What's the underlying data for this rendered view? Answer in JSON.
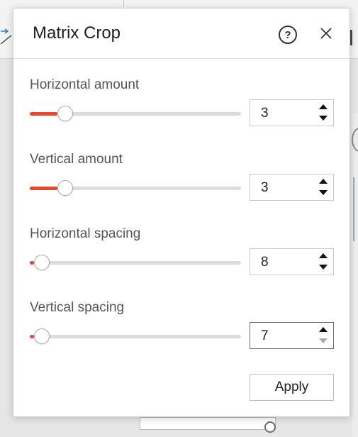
{
  "dialog": {
    "title": "Matrix Crop",
    "help_icon": "help-circle-icon",
    "close_icon": "close-icon",
    "accent_color": "#e8472f"
  },
  "controls": [
    {
      "label": "Horizontal amount",
      "value": "3",
      "fraction": 0.13
    },
    {
      "label": "Vertical amount",
      "value": "3",
      "fraction": 0.13
    },
    {
      "label": "Horizontal spacing",
      "value": "8",
      "fraction": 0.02
    },
    {
      "label": "Vertical spacing",
      "value": "7",
      "fraction": 0.02
    }
  ],
  "apply_label": "Apply"
}
